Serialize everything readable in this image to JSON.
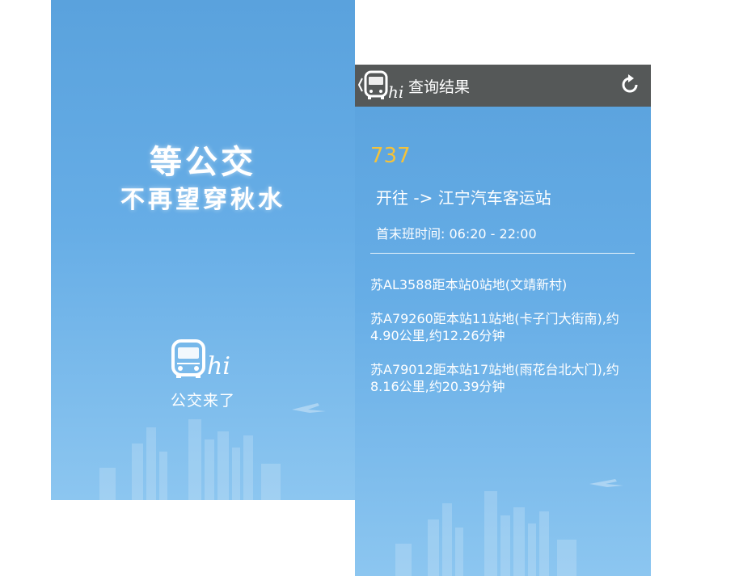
{
  "splash": {
    "slogan_line1": "等公交",
    "slogan_line2": "不再望穿秋水",
    "app_name": "公交来了",
    "logo_icon": "bus-hi-logo-icon"
  },
  "result": {
    "title": "查询结果",
    "route_number": "737",
    "direction": "开往 -> 江宁汽车客运站",
    "timing": "首末班时间: 06:20 - 22:00",
    "buses": [
      {
        "text": "苏AL3588距本站0站地(文靖新村)"
      },
      {
        "text": "苏A79260距本站11站地(卡子门大街南),约4.90公里,约12.26分钟"
      },
      {
        "text": "苏A79012距本站17站地(雨花台北大门),约8.16公里,约20.39分钟"
      }
    ],
    "icons": [
      "back-chevron-icon",
      "bus-hi-logo-icon",
      "refresh-icon"
    ]
  },
  "colors": {
    "background_top": "#5aa2dd",
    "background_bottom": "#8cc6f0",
    "topbar": "#555858",
    "route_number": "#f4c23a",
    "text": "#ffffff"
  }
}
